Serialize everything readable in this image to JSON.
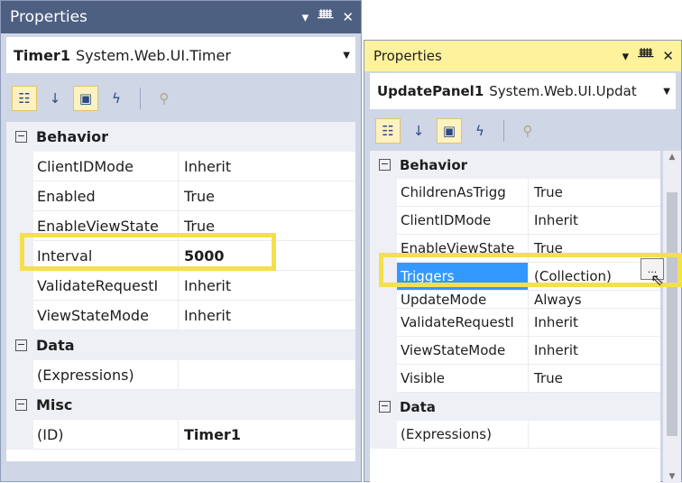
{
  "panel1": {
    "title": "Properties",
    "object_name": "Timer1",
    "object_type": "System.Web.UI.Timer",
    "categories": [
      {
        "label": "Behavior",
        "rows": [
          {
            "name": "ClientIDMode",
            "value": "Inherit"
          },
          {
            "name": "Enabled",
            "value": "True"
          },
          {
            "name": "EnableViewState",
            "value": "True"
          },
          {
            "name": "Interval",
            "value": "5000"
          },
          {
            "name": "ValidateRequestI",
            "value": "Inherit"
          },
          {
            "name": "ViewStateMode",
            "value": "Inherit"
          }
        ]
      },
      {
        "label": "Data",
        "rows": [
          {
            "name": "(Expressions)",
            "value": ""
          }
        ]
      },
      {
        "label": "Misc",
        "rows": [
          {
            "name": "(ID)",
            "value": "Timer1"
          }
        ]
      }
    ]
  },
  "panel2": {
    "title": "Properties",
    "object_name": "UpdatePanel1",
    "object_type": "System.Web.UI.Updat",
    "categories": [
      {
        "label": "Behavior",
        "rows": [
          {
            "name": "ChildrenAsTrigg",
            "value": "True"
          },
          {
            "name": "ClientIDMode",
            "value": "Inherit"
          },
          {
            "name": "EnableViewState",
            "value": "True"
          },
          {
            "name": "Triggers",
            "value": "(Collection)"
          },
          {
            "name": "UpdateMode",
            "value": "Always"
          },
          {
            "name": "ValidateRequestI",
            "value": "Inherit"
          },
          {
            "name": "ViewStateMode",
            "value": "Inherit"
          },
          {
            "name": "Visible",
            "value": "True"
          }
        ]
      },
      {
        "label": "Data",
        "rows": [
          {
            "name": "(Expressions)",
            "value": ""
          }
        ]
      }
    ]
  },
  "icons": {
    "window_controls": [
      "dropdown-arrow-icon",
      "pin-icon",
      "close-icon"
    ],
    "toolbar": [
      "categorized-icon",
      "alphabetical-icon",
      "properties-icon",
      "events-icon",
      "property-pages-icon"
    ],
    "ellipsis": "...",
    "cursor": "mouse-pointer-icon"
  },
  "colors": {
    "panel1_titlebar": "#4d6082",
    "panel2_titlebar": "#fff29d",
    "highlight_box": "#f4e04d",
    "selected_row": "#3399ff"
  }
}
